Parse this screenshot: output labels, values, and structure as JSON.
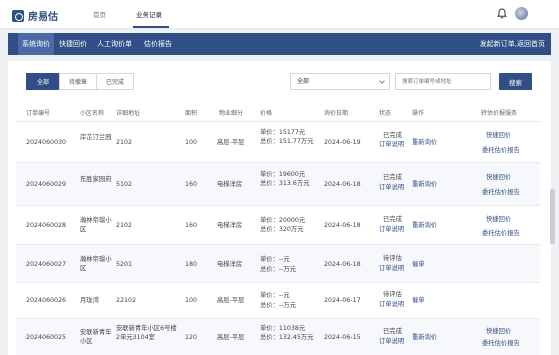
{
  "header": {
    "logo_text": "房易估",
    "nav": [
      {
        "label": "首页"
      },
      {
        "label": "业务记录"
      }
    ],
    "user_name": "",
    "icons": [
      "bell-icon",
      "avatar"
    ]
  },
  "tabs": {
    "items": [
      {
        "label": "系统询价",
        "active": true
      },
      {
        "label": "快捷回价"
      },
      {
        "label": "人工询价单"
      },
      {
        "label": "估价报告"
      }
    ],
    "right_link": "发起新订单,返回首页"
  },
  "filters": {
    "status_buttons": [
      {
        "label": "全部",
        "active": true
      },
      {
        "label": "待撤章"
      },
      {
        "label": "已完成"
      }
    ],
    "select_value": "全部",
    "search_placeholder": "搜索订单编号或地址",
    "search_button": "搜索"
  },
  "table": {
    "columns": [
      "订单编号",
      "小区名称",
      "详细地址",
      "面积",
      "物业细分",
      "价格",
      "询价日期",
      "状态",
      "操作",
      "转估价报服务"
    ],
    "rows": [
      {
        "order_no": "2024060030",
        "community": "岸芷汀兰园",
        "address": "2102",
        "area": "100",
        "property": "高层-平层",
        "price_unit": "单价：15177元",
        "price_total": "总价：151.77万元",
        "date": "2024-06-19",
        "status": "已完成",
        "status_link": "订单说明",
        "op": "重新询价",
        "service1": "快捷回价",
        "service2": "委托估价报告"
      },
      {
        "order_no": "2024060029",
        "community": "东胜家园府",
        "address": "5102",
        "area": "160",
        "property": "电梯洋房",
        "price_unit": "单价：19600元",
        "price_total": "总价：313.6万元",
        "date": "2024-06-18",
        "status": "已完成",
        "status_link": "订单说明",
        "op": "重新询价",
        "service1": "快捷回价",
        "service2": "委托估价报告"
      },
      {
        "order_no": "2024060028",
        "community": "瀚林帝璟小区",
        "address": "2102",
        "area": "160",
        "property": "电梯洋房",
        "price_unit": "单价：20000元",
        "price_total": "总价：320万元",
        "date": "2024-06-18",
        "status": "已完成",
        "status_link": "订单说明",
        "op": "重新询价",
        "service1": "快捷回价",
        "service2": "委托估价报告"
      },
      {
        "order_no": "2024060027",
        "community": "瀚林帝璟小区",
        "address": "5201",
        "area": "180",
        "property": "电梯洋房",
        "price_unit": "单价：--元",
        "price_total": "总价：--万元",
        "date": "2024-06-18",
        "status": "待评估",
        "status_link": "订单说明",
        "op": "催单",
        "service1": "",
        "service2": ""
      },
      {
        "order_no": "2024060026",
        "community": "月珑湾",
        "address": "22102",
        "area": "100",
        "property": "高层-平层",
        "price_unit": "单价：--元",
        "price_total": "总价：--万元",
        "date": "2024-06-17",
        "status": "待评估",
        "status_link": "订单说明",
        "op": "催单",
        "service1": "",
        "service2": ""
      },
      {
        "order_no": "2024060025",
        "community": "安联新青年小区",
        "address": "安联新青年小区6号楼2单元3104室",
        "area": "120",
        "property": "高层-平层",
        "price_unit": "单价：11038元",
        "price_total": "总价：132.45万元",
        "date": "2024-06-15",
        "status": "已完成",
        "status_link": "订单说明",
        "op": "重新询价",
        "service1": "快捷回价",
        "service2": "委托估价报告"
      }
    ]
  },
  "colors": {
    "primary": "#2f4f86",
    "tab_active": "#4a6aa5",
    "row_alt": "#f6f8fb"
  }
}
